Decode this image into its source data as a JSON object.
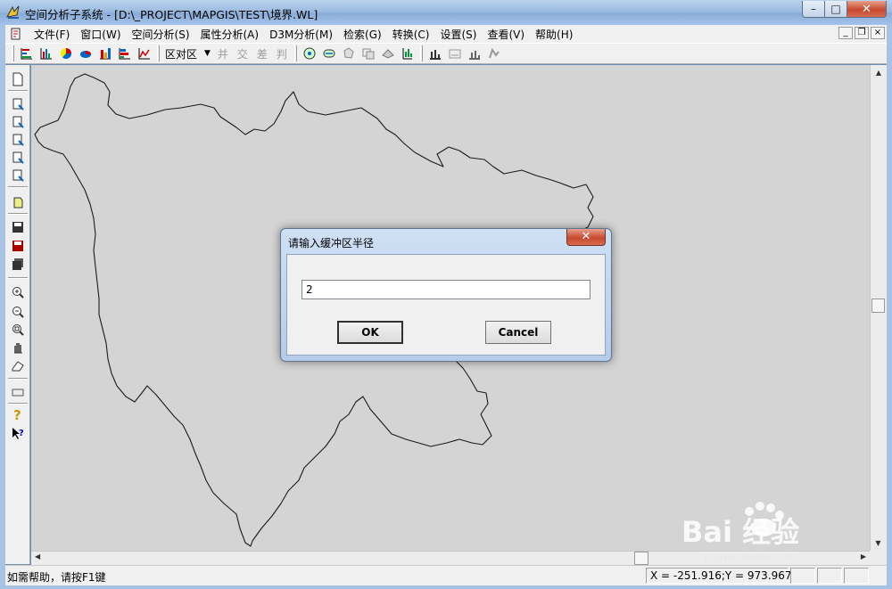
{
  "window": {
    "title": "空间分析子系统 - [D:\\_PROJECT\\MAPGIS\\TEST\\境界.WL]",
    "min_label": "–",
    "max_label": "□",
    "close_label": "✕"
  },
  "menubar": {
    "items": [
      {
        "label": "文件(F)"
      },
      {
        "label": "窗口(W)"
      },
      {
        "label": "空间分析(S)"
      },
      {
        "label": "属性分析(A)"
      },
      {
        "label": "D3M分析(M)"
      },
      {
        "label": "检索(G)"
      },
      {
        "label": "转换(C)"
      },
      {
        "label": "设置(S)"
      },
      {
        "label": "查看(V)"
      },
      {
        "label": "帮助(H)"
      }
    ],
    "mdi_min": "_",
    "mdi_restore": "❐",
    "mdi_close": "×"
  },
  "toolbar": {
    "combo_value": "区对区",
    "op_union": "并",
    "op_intersect": "交",
    "op_diff": "差",
    "op_judge": "判"
  },
  "dialog": {
    "title": "请输入缓冲区半径",
    "input_value": "2",
    "ok_label": "OK",
    "cancel_label": "Cancel",
    "close_label": "✕"
  },
  "statusbar": {
    "help_text": "如需帮助，请按F1键",
    "coords": "X = -251.916;Y = 973.967"
  },
  "watermark": {
    "text": "Bai 经验",
    "sub": "jingyan.baidu.com"
  },
  "colors": {
    "map_bg": "#d4d4d4",
    "boundary": "#1a1a1a",
    "close_red": "#c74a2f"
  }
}
